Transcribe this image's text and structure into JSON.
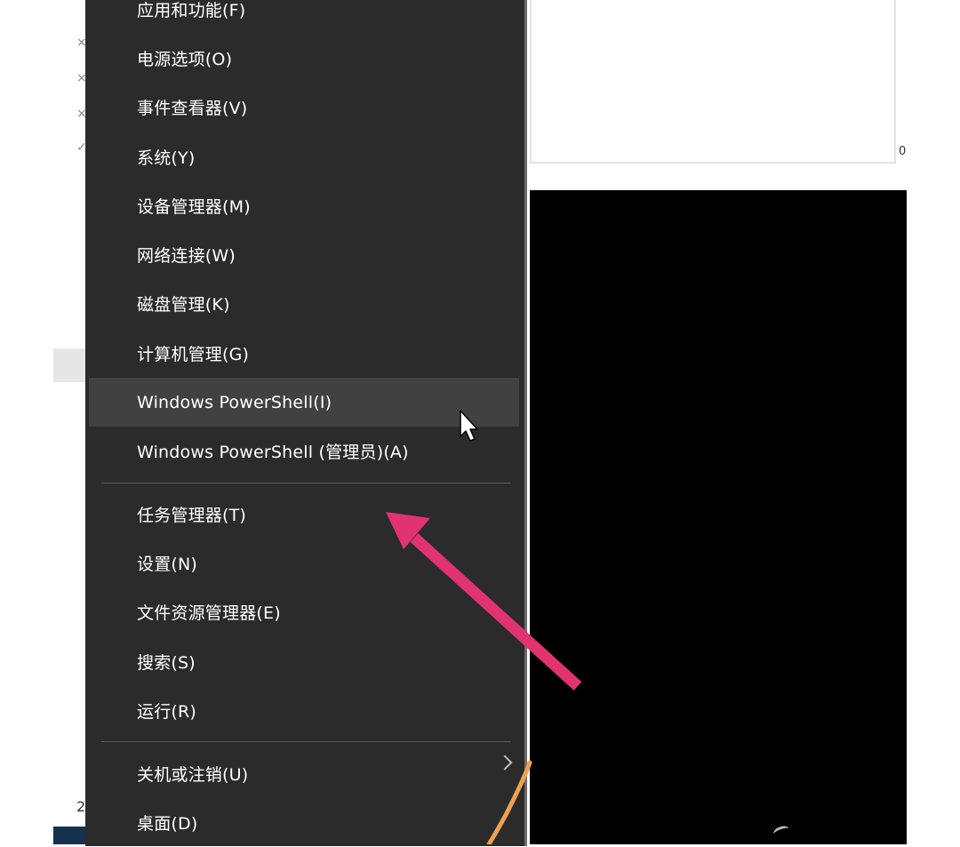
{
  "menu": {
    "items": [
      {
        "label": "应用和功能(F)"
      },
      {
        "label": "电源选项(O)"
      },
      {
        "label": "事件查看器(V)"
      },
      {
        "label": "系统(Y)"
      },
      {
        "label": "设备管理器(M)"
      },
      {
        "label": "网络连接(W)"
      },
      {
        "label": "磁盘管理(K)"
      },
      {
        "label": "计算机管理(G)"
      },
      {
        "label": "Windows PowerShell(I)"
      },
      {
        "label": "Windows PowerShell (管理员)(A)"
      },
      {
        "label": "任务管理器(T)"
      },
      {
        "label": "设置(N)"
      },
      {
        "label": "文件资源管理器(E)"
      },
      {
        "label": "搜索(S)"
      },
      {
        "label": "运行(R)"
      },
      {
        "label": "关机或注销(U)"
      },
      {
        "label": "桌面(D)"
      }
    ],
    "hovered_item": "Windows PowerShell(I)"
  },
  "background": {
    "bottom_left_text": "2",
    "right_edge_text": "0"
  },
  "annotations": {
    "arrow_color": "#e0336f",
    "curve_color": "#f0a050"
  },
  "colors": {
    "menu_bg": "#2b2b2b",
    "menu_hover": "#414141",
    "menu_text": "#ffffff"
  }
}
